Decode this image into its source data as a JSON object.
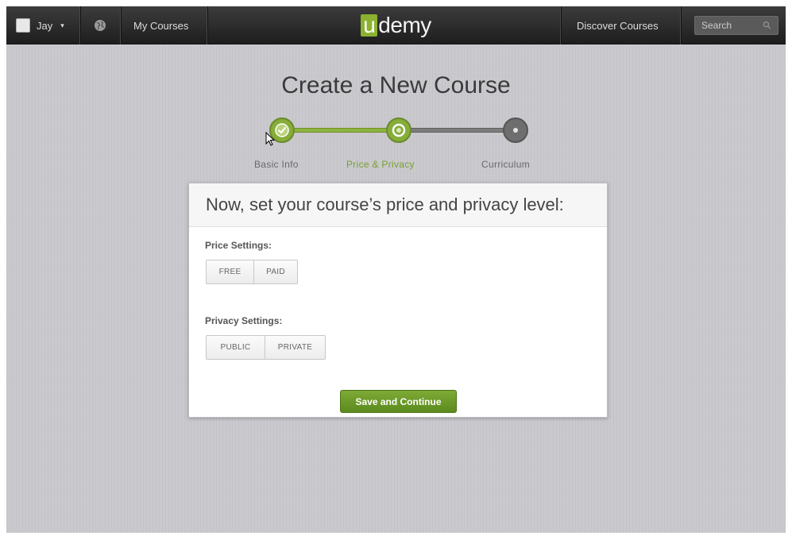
{
  "nav": {
    "user_name": "Jay",
    "user_caret": "▾",
    "my_courses": "My Courses",
    "logo_u": "u",
    "logo_rest": "demy",
    "discover": "Discover Courses",
    "search_placeholder": "Search",
    "search_icon_glyph": "⚲",
    "globe_icon": "globe-icon",
    "avatar_icon": "avatar"
  },
  "page": {
    "title": "Create a New Course"
  },
  "steps": [
    {
      "label": "Basic Info",
      "state": "completed"
    },
    {
      "label": "Price & Privacy",
      "state": "current"
    },
    {
      "label": "Curriculum",
      "state": "upcoming"
    }
  ],
  "card": {
    "heading": "Now, set your course’s price and privacy level:",
    "price_label": "Price Settings:",
    "price_options": [
      "FREE",
      "PAID"
    ],
    "privacy_label": "Privacy Settings:",
    "privacy_options": [
      "PUBLIC",
      "PRIVATE"
    ],
    "save_button": "Save and Continue"
  },
  "colors": {
    "brand_green": "#8bb22f",
    "topbar": "#2a2a2a",
    "background": "#c9c8cd"
  }
}
